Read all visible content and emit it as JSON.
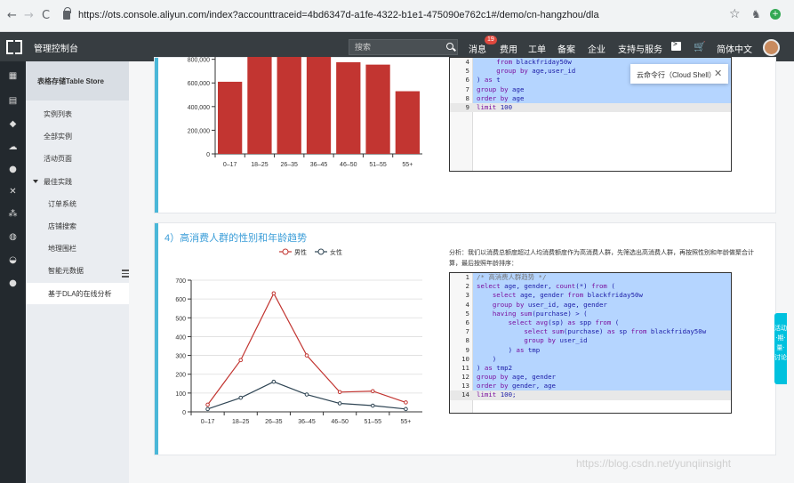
{
  "browser": {
    "url": "https://ots.console.aliyun.com/index?accounttraceid=4bd6347d-a1fe-4322-b1e1-475090e762c1#/demo/cn-hangzhou/dla"
  },
  "topbar": {
    "brand": "管理控制台",
    "search_placeholder": "搜索",
    "messages": "消息",
    "messages_badge": "19",
    "billing": "费用",
    "tickets": "工单",
    "icp": "备案",
    "enterprise": "企业",
    "support": "支持与服务",
    "language": "简体中文"
  },
  "sidebar": {
    "title": "表格存储Table Store",
    "items": [
      {
        "label": "实例列表"
      },
      {
        "label": "全部实例"
      },
      {
        "label": "活动页面"
      },
      {
        "label": "最佳实践"
      },
      {
        "label": "订单系统"
      },
      {
        "label": "店铺搜索"
      },
      {
        "label": "地理围栏"
      },
      {
        "label": "智能元数据"
      },
      {
        "label": "基于DLA的在线分析"
      }
    ]
  },
  "editor1": {
    "lines": [
      {
        "n": "4",
        "text": "     from blackfriday50w"
      },
      {
        "n": "5",
        "text": "     group by age,user_id"
      },
      {
        "n": "6",
        "text": ") as t"
      },
      {
        "n": "7",
        "text": "group by age"
      },
      {
        "n": "8",
        "text": "order by age"
      },
      {
        "n": "9",
        "text": "limit 100"
      }
    ]
  },
  "tooltip": {
    "text": "云命令行（Cloud Shell）",
    "close": "✕"
  },
  "section2": {
    "title": "4）高消费人群的性别和年龄趋势",
    "description": "分析：我们以消费总额度超过人均消费额度作为高消费人群，先筛选出高消费人群，再按照性别和年龄做聚合计算，最后按照年龄排序："
  },
  "editor2": {
    "lines": [
      {
        "n": "1",
        "text": "/* 高消费人群趋势 */"
      },
      {
        "n": "2",
        "text": "select age, gender, count(*) from ("
      },
      {
        "n": "3",
        "text": "    select age, gender from blackfriday50w"
      },
      {
        "n": "4",
        "text": "    group by user_id, age, gender"
      },
      {
        "n": "5",
        "text": "    having sum(purchase) > ("
      },
      {
        "n": "6",
        "text": "        select avg(sp) as spp from ("
      },
      {
        "n": "7",
        "text": "            select sum(purchase) as sp from blackfriday50w"
      },
      {
        "n": "8",
        "text": "            group by user_id"
      },
      {
        "n": "9",
        "text": "        ) as tmp"
      },
      {
        "n": "10",
        "text": "    )"
      },
      {
        "n": "11",
        "text": ") as tmp2"
      },
      {
        "n": "12",
        "text": "group by age, gender"
      },
      {
        "n": "13",
        "text": "order by gender, age"
      },
      {
        "n": "14",
        "text": "limit 100;"
      }
    ]
  },
  "float_tab": "活动·期·量·讨论",
  "watermark": "https://blog.csdn.net/yunqiinsight",
  "chart_data": [
    {
      "type": "bar",
      "categories": [
        "0–17",
        "18–25",
        "26–35",
        "36–45",
        "46–50",
        "51–55",
        "55+"
      ],
      "values": [
        610000,
        820000,
        820000,
        820000,
        775000,
        755000,
        530000
      ],
      "ytick_labels": [
        "0",
        "200,000",
        "400,000",
        "600,000",
        "800,000"
      ],
      "ylim": [
        0,
        820000
      ],
      "color": "#c23531"
    },
    {
      "type": "line",
      "categories": [
        "0–17",
        "18–25",
        "26–35",
        "36–45",
        "46–50",
        "51–55",
        "55+"
      ],
      "series": [
        {
          "name": "男性",
          "values": [
            38,
            275,
            630,
            300,
            105,
            110,
            50
          ],
          "color": "#c23531"
        },
        {
          "name": "女性",
          "values": [
            15,
            75,
            160,
            92,
            45,
            33,
            15
          ],
          "color": "#2f4554"
        }
      ],
      "ytick_labels": [
        "0",
        "100",
        "200",
        "300",
        "400",
        "500",
        "600",
        "700"
      ],
      "ylim": [
        0,
        700
      ],
      "legend": "top-center",
      "grid": true
    }
  ]
}
